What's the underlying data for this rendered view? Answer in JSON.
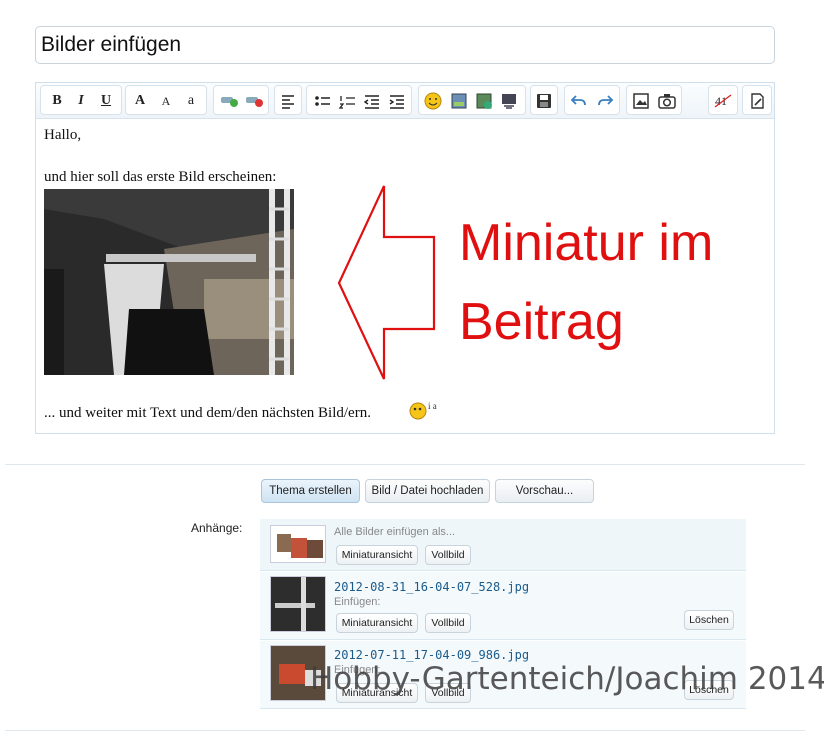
{
  "title_input": {
    "value": "Bilder einfügen"
  },
  "toolbar": {
    "buttons": [
      "bold-icon",
      "italic-icon",
      "underline-icon",
      "font-color-icon",
      "font-size-icon",
      "font-family-icon",
      "link-icon",
      "unlink-icon",
      "align-icon",
      "bullet-list-icon",
      "numbered-list-icon",
      "outdent-icon",
      "indent-icon",
      "smiley-icon",
      "image-icon",
      "media-icon",
      "quote-icon",
      "save-icon",
      "undo-icon",
      "redo-icon",
      "insert-image-icon",
      "camera-icon",
      "spellcheck-icon",
      "source-icon"
    ],
    "bold": "B",
    "italic": "I",
    "underline": "U",
    "font_color": "A",
    "font_size": "A",
    "font_family": "a"
  },
  "editor": {
    "line1": "Hallo,",
    "line2": "und hier soll das erste Bild erscheinen:",
    "line3": "... und weiter mit Text und dem/den nächsten Bild/ern.",
    "annotation_line1": "Miniatur im",
    "annotation_line2": "Beitrag"
  },
  "actions": {
    "create": "Thema erstellen",
    "upload": "Bild / Datei hochladen",
    "preview": "Vorschau..."
  },
  "attachments": {
    "label": "Anhänge:",
    "insert_all": "Alle Bilder einfügen als...",
    "thumb_btn": "Miniaturansicht",
    "full_btn": "Vollbild",
    "insert_label": "Einfügen:",
    "delete_btn": "Löschen",
    "files": [
      {
        "name": "2012-08-31_16-04-07_528.jpg"
      },
      {
        "name": "2012-07-11_17-04-09_986.jpg"
      }
    ]
  },
  "watermark": "Hobby-Gartenteich/Joachim 2014"
}
